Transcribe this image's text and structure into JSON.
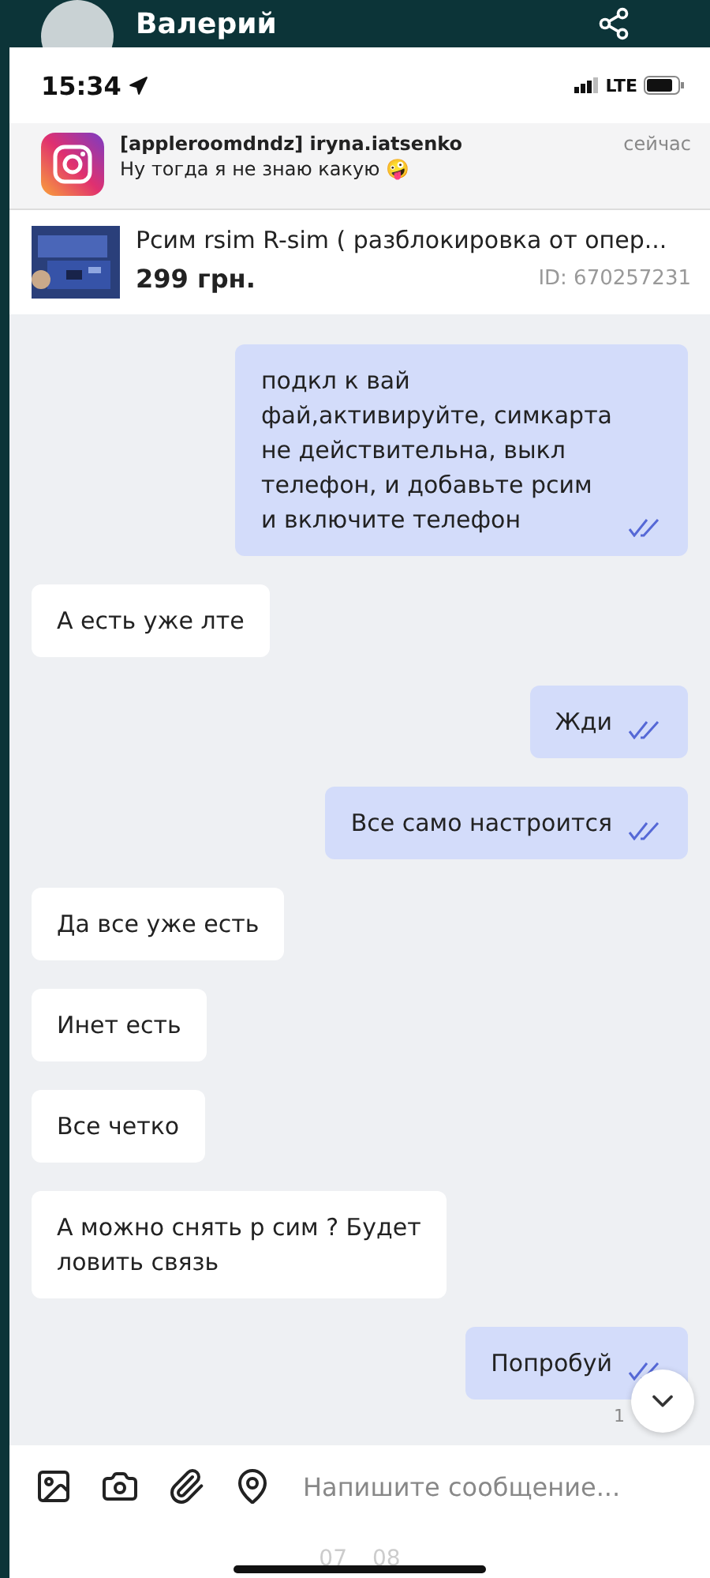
{
  "header": {
    "name": "Валерий"
  },
  "status_bar": {
    "time": "15:34",
    "network": "LTE"
  },
  "notification": {
    "title": "[appleroomdndz] iryna.iatsenko",
    "body": "Ну тогда я не знаю какую 🤪",
    "time": "сейчас"
  },
  "listing": {
    "title": "Рсим rsim R-sim ( разблокировка от опер...",
    "price": "299 грн.",
    "id": "ID: 670257231"
  },
  "messages": [
    {
      "kind": "out",
      "text": "подкл к вай\nфай,активируйте, симкарта\nне действительна, выкл\nтелефон, и добавьте рсим\nи включите телефон",
      "read": true
    },
    {
      "kind": "in",
      "text": "А есть уже лте"
    },
    {
      "kind": "out",
      "text": "Жди",
      "read": true
    },
    {
      "kind": "out",
      "text": "Все само настроится",
      "read": true
    },
    {
      "kind": "in",
      "text": "Да все уже есть"
    },
    {
      "kind": "in",
      "text": "Инет есть"
    },
    {
      "kind": "in",
      "text": "Все четко"
    },
    {
      "kind": "in",
      "text": "А можно снять р сим ? Будет\nловить связь"
    },
    {
      "kind": "out",
      "text": "Попробуй",
      "read": true
    }
  ],
  "last_time": "1",
  "composer": {
    "placeholder": "Напишите сообщение..."
  },
  "footer_dates": [
    "07",
    "08"
  ]
}
